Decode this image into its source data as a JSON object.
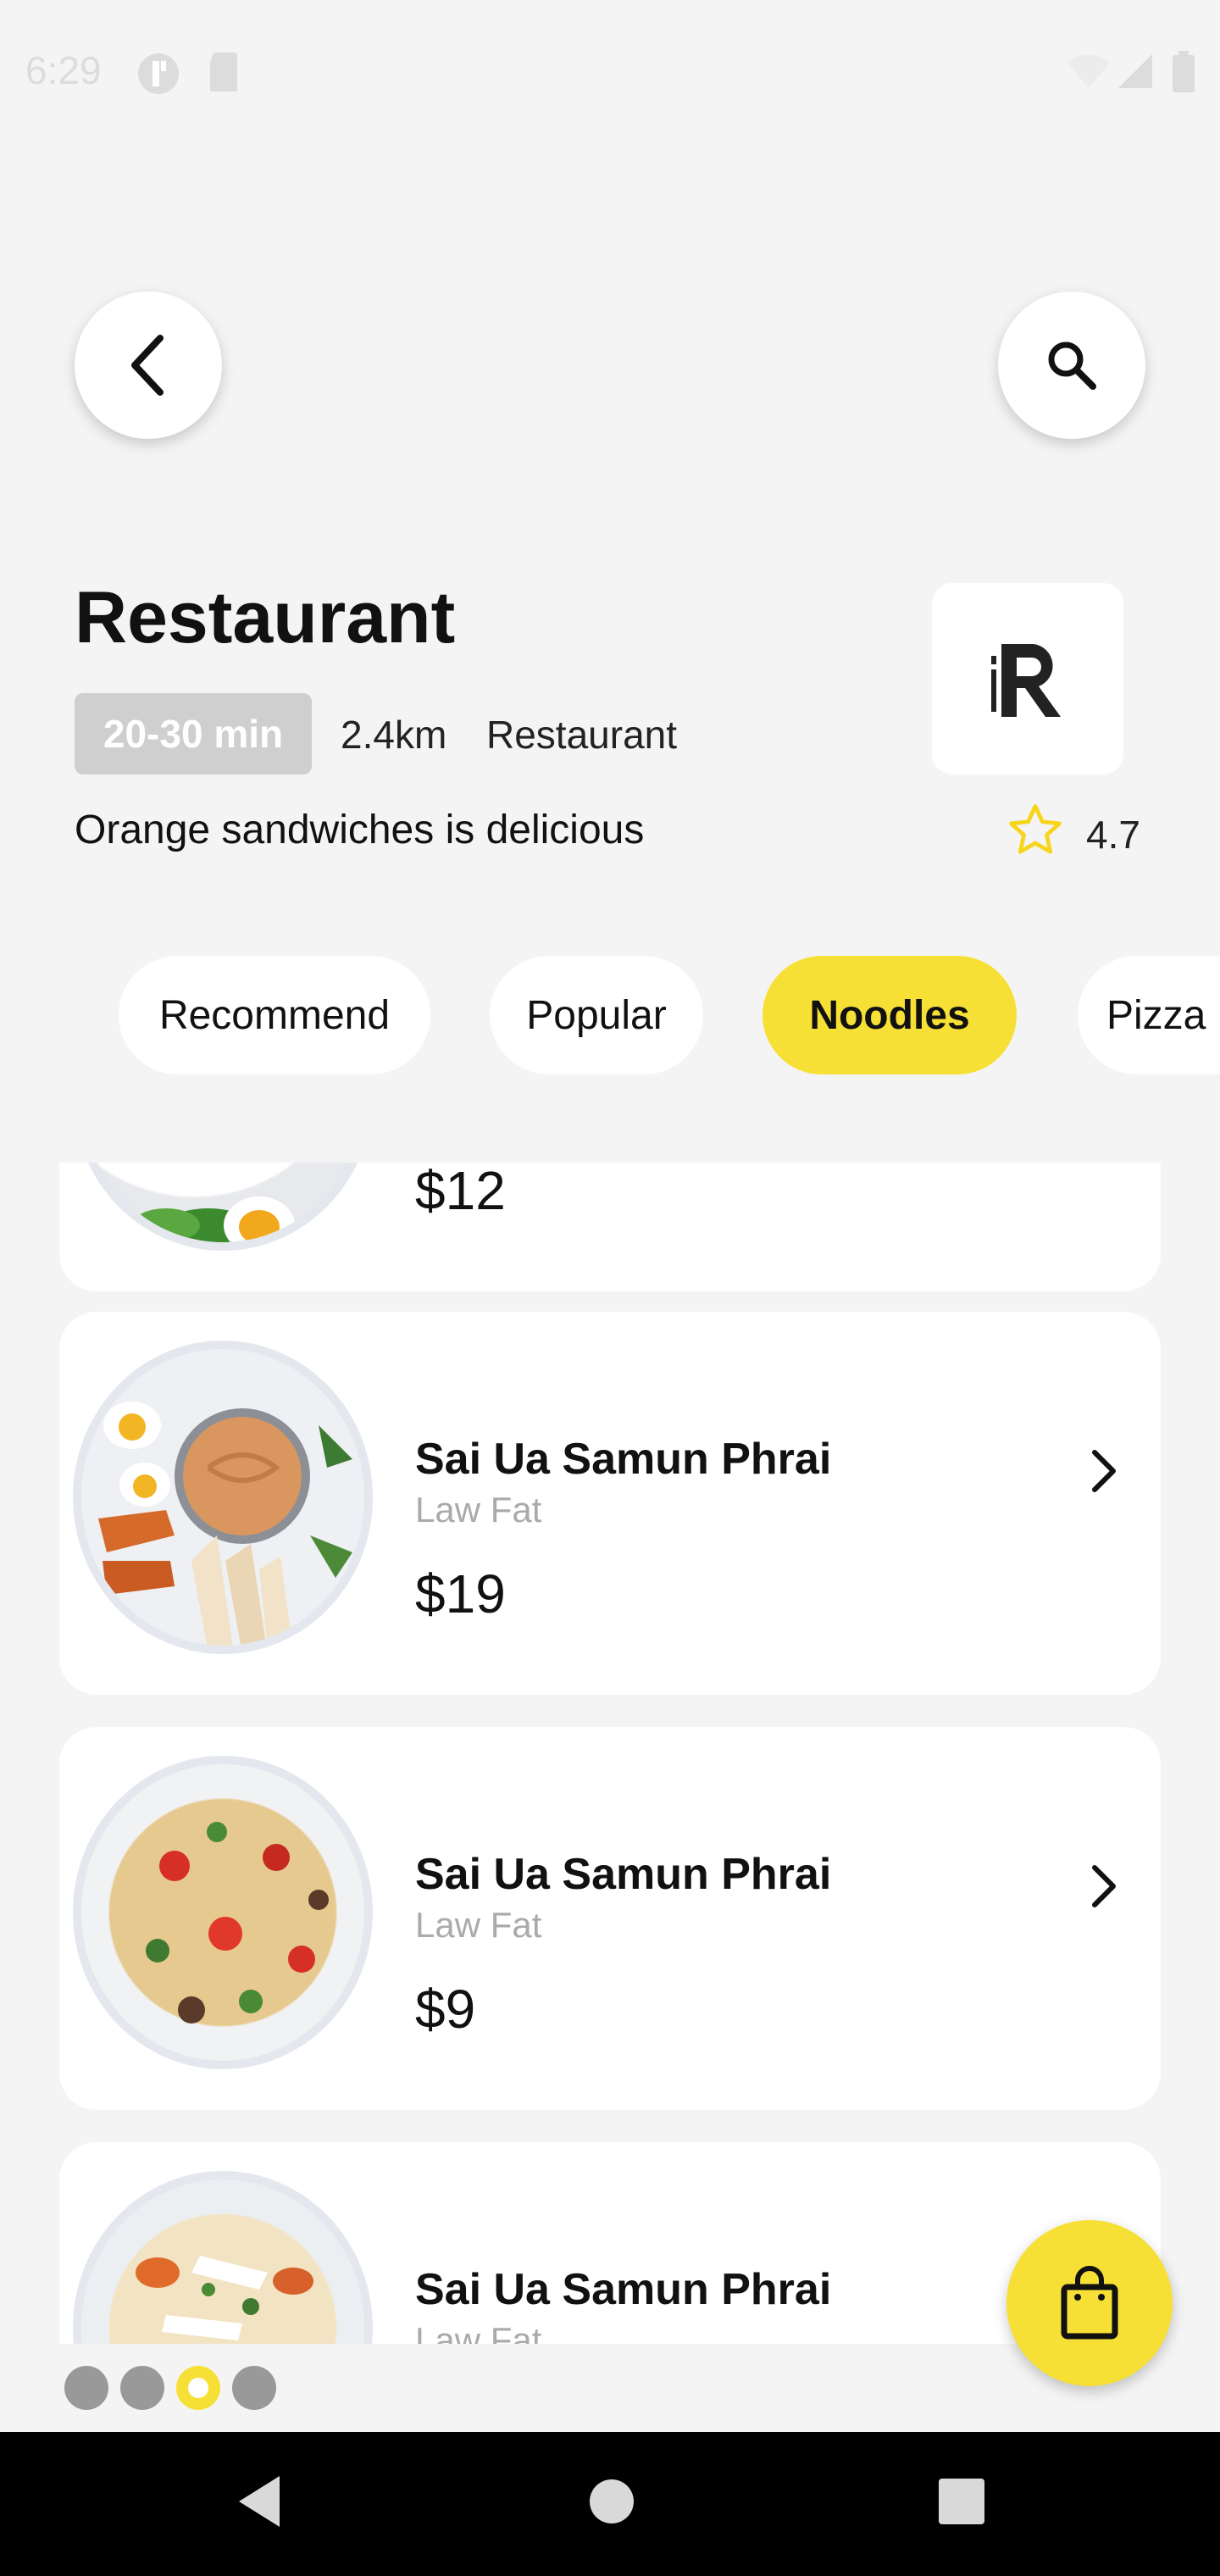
{
  "status_bar": {
    "time": "6:29"
  },
  "header": {
    "title": "Restaurant",
    "time_badge": "20-30 min",
    "distance": "2.4km",
    "category": "Restaurant",
    "description": "Orange sandwiches is delicious",
    "rating": "4.7"
  },
  "tabs": [
    {
      "label": "Recommend",
      "active": false
    },
    {
      "label": "Popular",
      "active": false
    },
    {
      "label": "Noodles",
      "active": true
    },
    {
      "label": "Pizza",
      "active": false
    }
  ],
  "menu_items": [
    {
      "name": "",
      "subtitle": "",
      "price": "$12"
    },
    {
      "name": "Sai Ua Samun Phrai",
      "subtitle": "Law Fat",
      "price": "$19"
    },
    {
      "name": "Sai Ua Samun Phrai",
      "subtitle": "Law Fat",
      "price": "$9"
    },
    {
      "name": "Sai Ua Samun Phrai",
      "subtitle": "Law Fat",
      "price": ""
    }
  ],
  "pagination": {
    "total": 4,
    "active_index": 2
  },
  "colors": {
    "accent": "#f7e035",
    "background": "#f4f4f4",
    "badge": "#cfcfcf"
  },
  "icons": [
    "back-arrow-icon",
    "search-icon",
    "star-icon",
    "chevron-right-icon",
    "shopping-bag-icon"
  ]
}
